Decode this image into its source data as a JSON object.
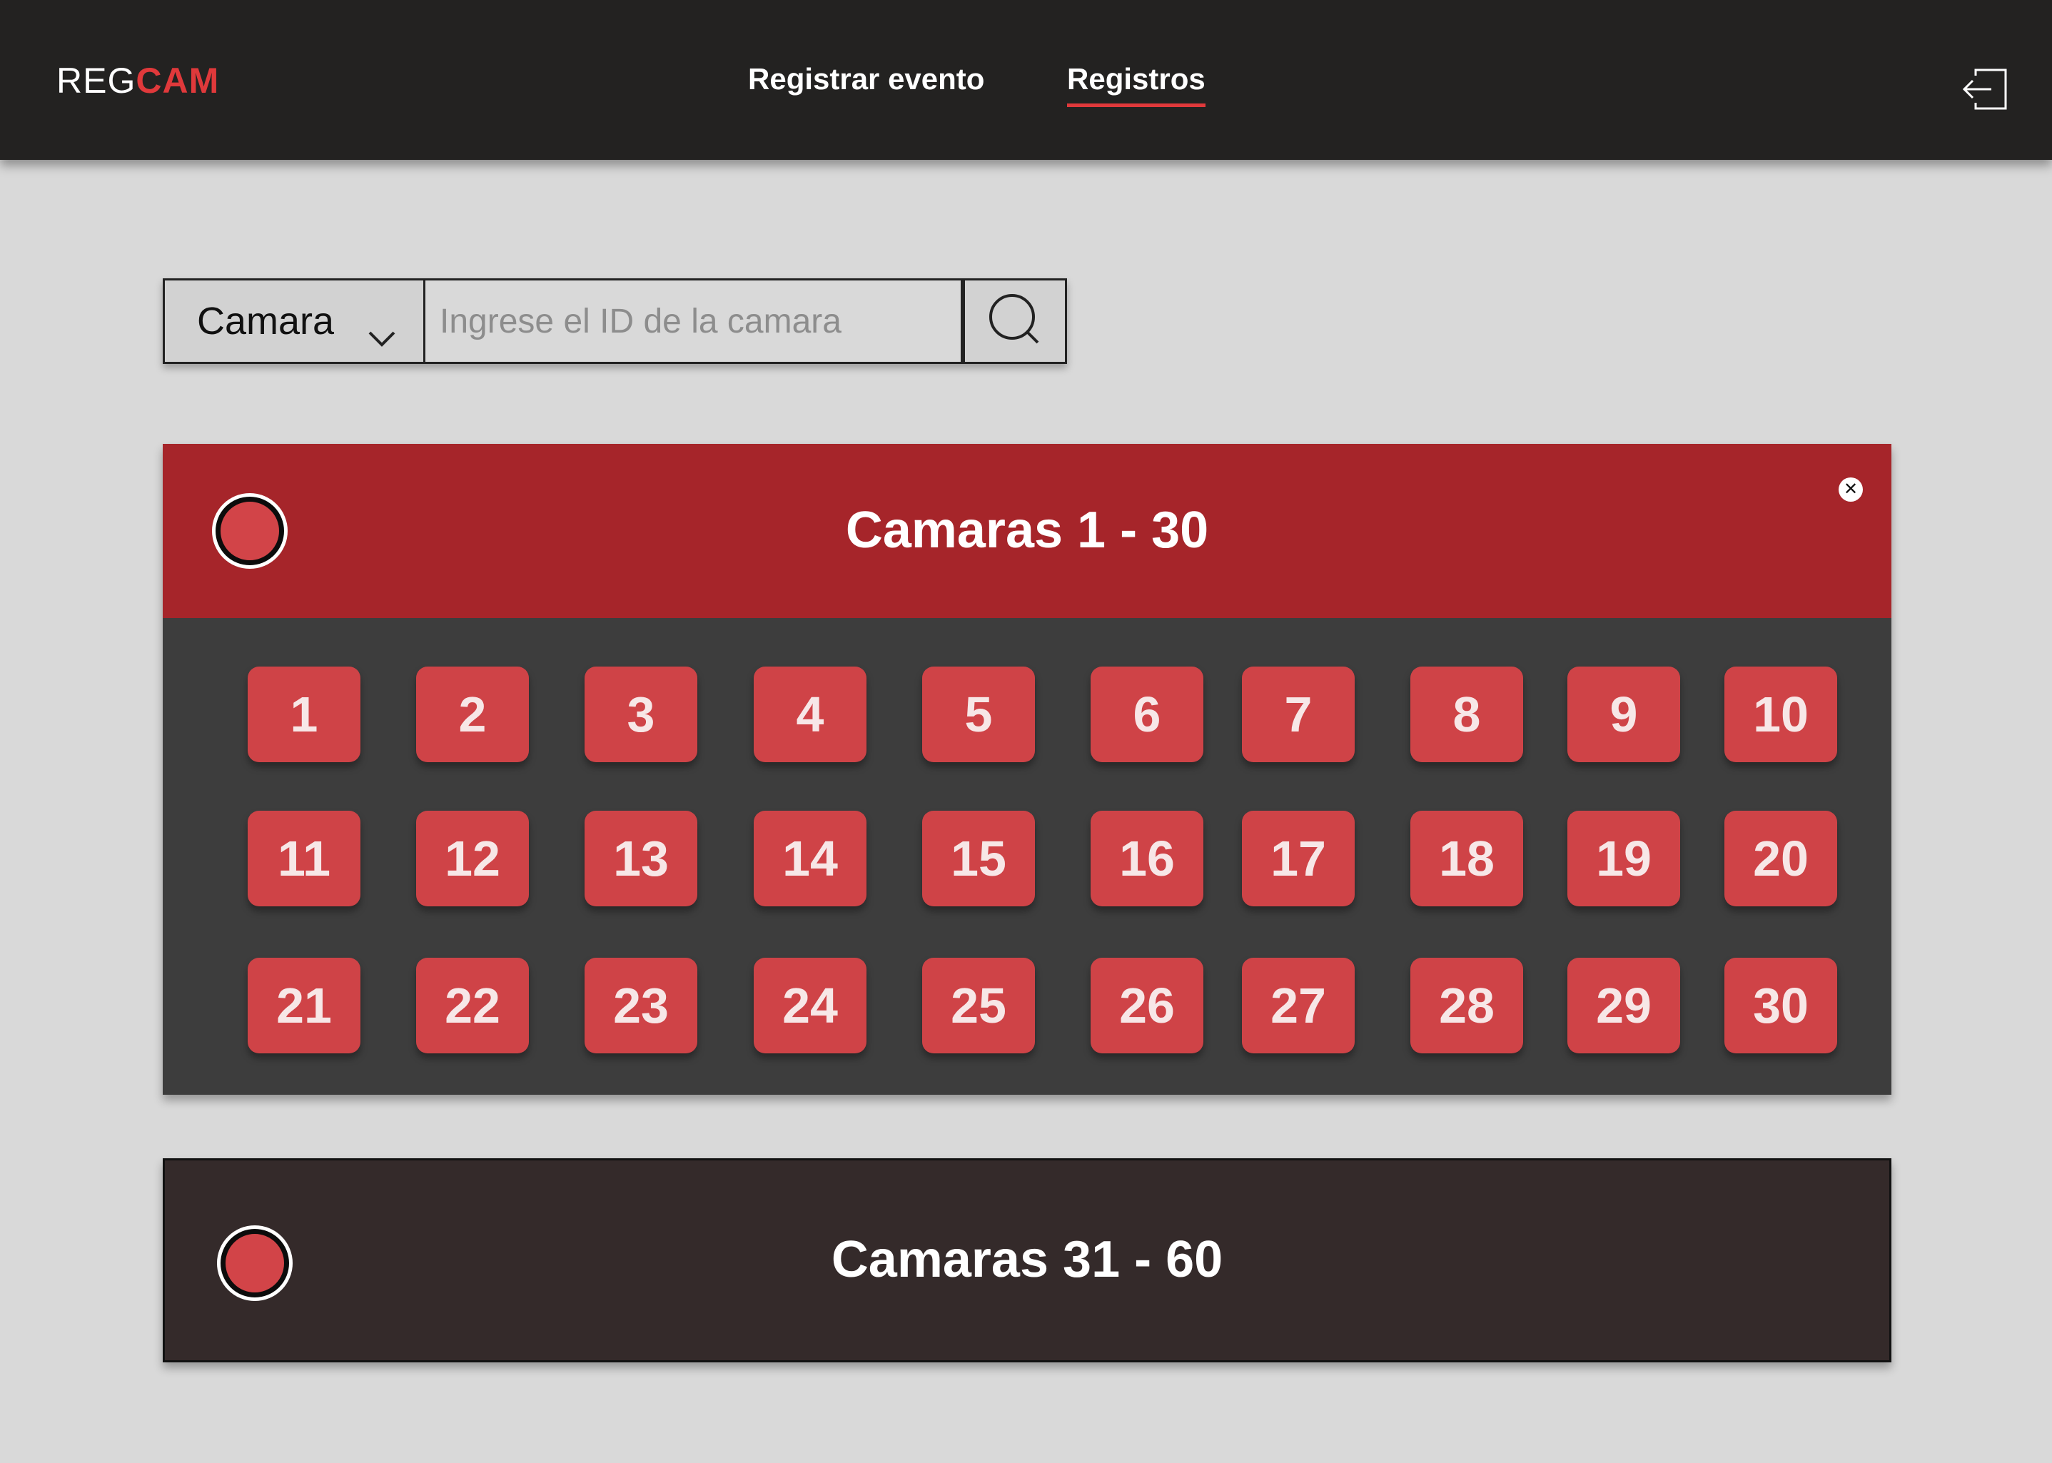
{
  "header": {
    "logo_prefix": "REG",
    "logo_accent": "CAM",
    "nav": [
      {
        "label": "Registrar evento",
        "active": false
      },
      {
        "label": "Registros",
        "active": true
      }
    ],
    "logout_icon": "logout-icon"
  },
  "search": {
    "filter_value": "Camara",
    "placeholder": "Ingrese el ID de la camara",
    "button_icon": "search-icon"
  },
  "groups": [
    {
      "title": "Camaras 1 - 30",
      "expanded": true,
      "status_icon": "record-icon",
      "close_icon": "close-icon",
      "cameras": [
        "1",
        "2",
        "3",
        "4",
        "5",
        "6",
        "7",
        "8",
        "9",
        "10",
        "11",
        "12",
        "13",
        "14",
        "15",
        "16",
        "17",
        "18",
        "19",
        "20",
        "21",
        "22",
        "23",
        "24",
        "25",
        "26",
        "27",
        "28",
        "29",
        "30"
      ]
    },
    {
      "title": "Camaras 31 - 60",
      "expanded": false,
      "status_icon": "record-icon"
    }
  ],
  "colors": {
    "accent": "#e0393b",
    "header_bg": "#232221",
    "group_open_header": "#a6252a",
    "group_body": "#3d3d3d",
    "camera_button": "#cf4347",
    "group_closed_bg": "#342a2a",
    "page_bg": "#d9d9d9"
  }
}
